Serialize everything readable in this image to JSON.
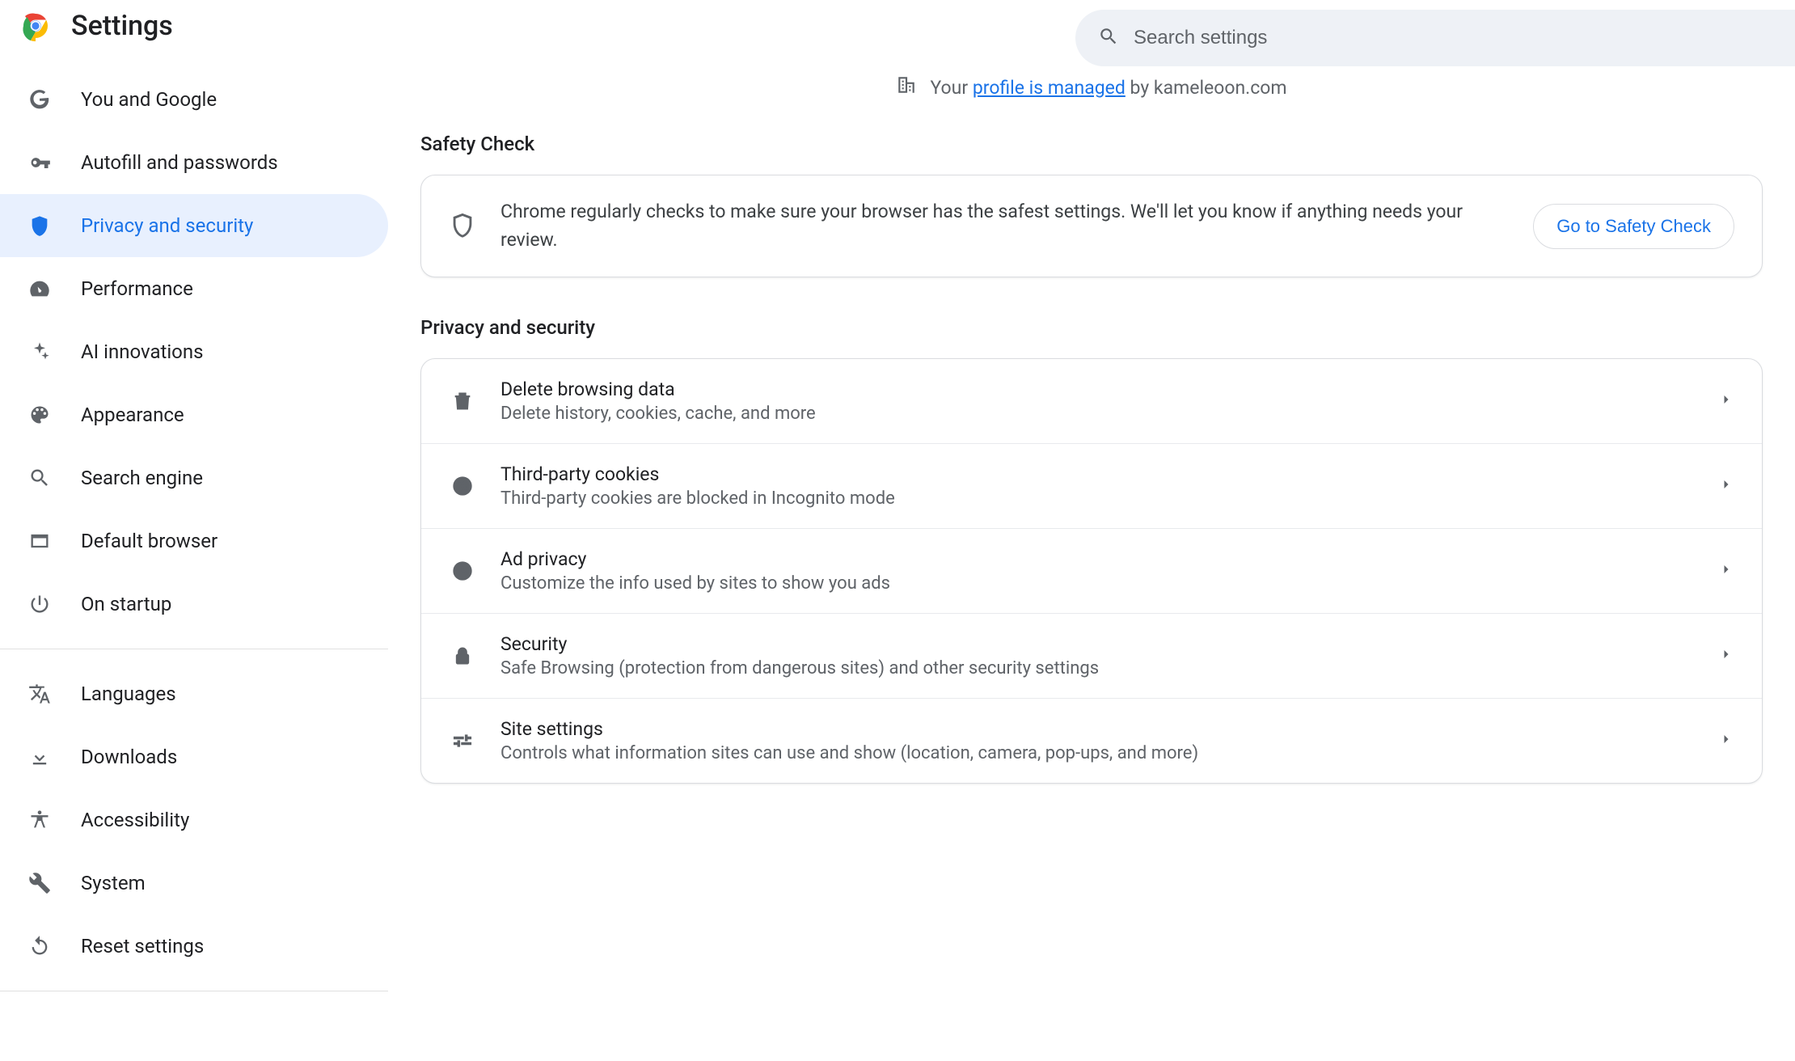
{
  "header": {
    "title": "Settings",
    "search_placeholder": "Search settings"
  },
  "sidebar": {
    "group1": [
      {
        "id": "you-and-google",
        "label": "You and Google"
      },
      {
        "id": "autofill",
        "label": "Autofill and passwords"
      },
      {
        "id": "privacy",
        "label": "Privacy and security",
        "active": true
      },
      {
        "id": "performance",
        "label": "Performance"
      },
      {
        "id": "ai",
        "label": "AI innovations"
      },
      {
        "id": "appearance",
        "label": "Appearance"
      },
      {
        "id": "search-engine",
        "label": "Search engine"
      },
      {
        "id": "default-browser",
        "label": "Default browser"
      },
      {
        "id": "startup",
        "label": "On startup"
      }
    ],
    "group2": [
      {
        "id": "languages",
        "label": "Languages"
      },
      {
        "id": "downloads",
        "label": "Downloads"
      },
      {
        "id": "accessibility",
        "label": "Accessibility"
      },
      {
        "id": "system",
        "label": "System"
      },
      {
        "id": "reset",
        "label": "Reset settings"
      }
    ]
  },
  "managed_banner": {
    "prefix": "Your ",
    "link_text": "profile is managed",
    "suffix": " by kameleoon.com"
  },
  "safety_check": {
    "section_title": "Safety Check",
    "description": "Chrome regularly checks to make sure your browser has the safest settings. We'll let you know if anything needs your review.",
    "button_label": "Go to Safety Check"
  },
  "privacy_section": {
    "section_title": "Privacy and security",
    "rows": [
      {
        "id": "delete-data",
        "title": "Delete browsing data",
        "sub": "Delete history, cookies, cache, and more"
      },
      {
        "id": "cookies",
        "title": "Third-party cookies",
        "sub": "Third-party cookies are blocked in Incognito mode"
      },
      {
        "id": "ad-privacy",
        "title": "Ad privacy",
        "sub": "Customize the info used by sites to show you ads"
      },
      {
        "id": "security",
        "title": "Security",
        "sub": "Safe Browsing (protection from dangerous sites) and other security settings"
      },
      {
        "id": "site-settings",
        "title": "Site settings",
        "sub": "Controls what information sites can use and show (location, camera, pop-ups, and more)"
      }
    ]
  }
}
